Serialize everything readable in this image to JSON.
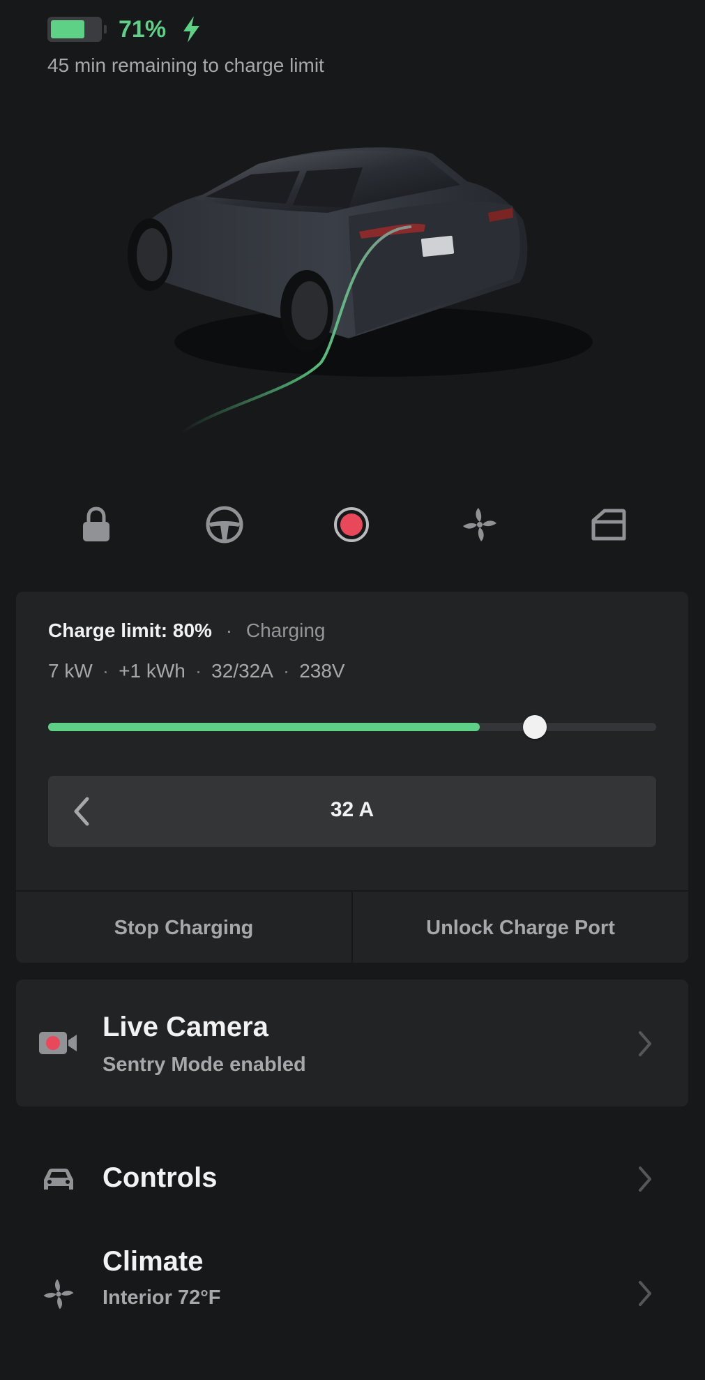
{
  "status": {
    "battery_level": 0.71,
    "battery_percent": "71%",
    "charge_time": "45 min remaining to charge limit",
    "accent_color": "#5ed187",
    "charging_icon": "bolt-icon"
  },
  "quick_actions": [
    {
      "name": "lock",
      "icon": "lock-icon"
    },
    {
      "name": "steering",
      "icon": "steering-wheel-icon"
    },
    {
      "name": "sentry",
      "icon": "record-icon"
    },
    {
      "name": "climate",
      "icon": "fan-icon"
    },
    {
      "name": "trunk",
      "icon": "frunk-icon"
    }
  ],
  "charging": {
    "limit_label": "Charge limit: 80%",
    "separator": "·",
    "status": "Charging",
    "stats": [
      "7 kW",
      "+1 kWh",
      "32/32A",
      "238V"
    ],
    "current_level": 0.71,
    "limit_level": 0.8,
    "amps": "32 A",
    "stop_label": "Stop Charging",
    "unlock_label": "Unlock Charge Port"
  },
  "camera": {
    "title": "Live Camera",
    "subtitle": "Sentry Mode enabled",
    "icon": "camera-record-icon"
  },
  "menu": {
    "controls": {
      "title": "Controls",
      "icon": "car-icon"
    },
    "climate": {
      "title": "Climate",
      "subtitle": "Interior 72°F",
      "icon": "fan-icon"
    }
  }
}
